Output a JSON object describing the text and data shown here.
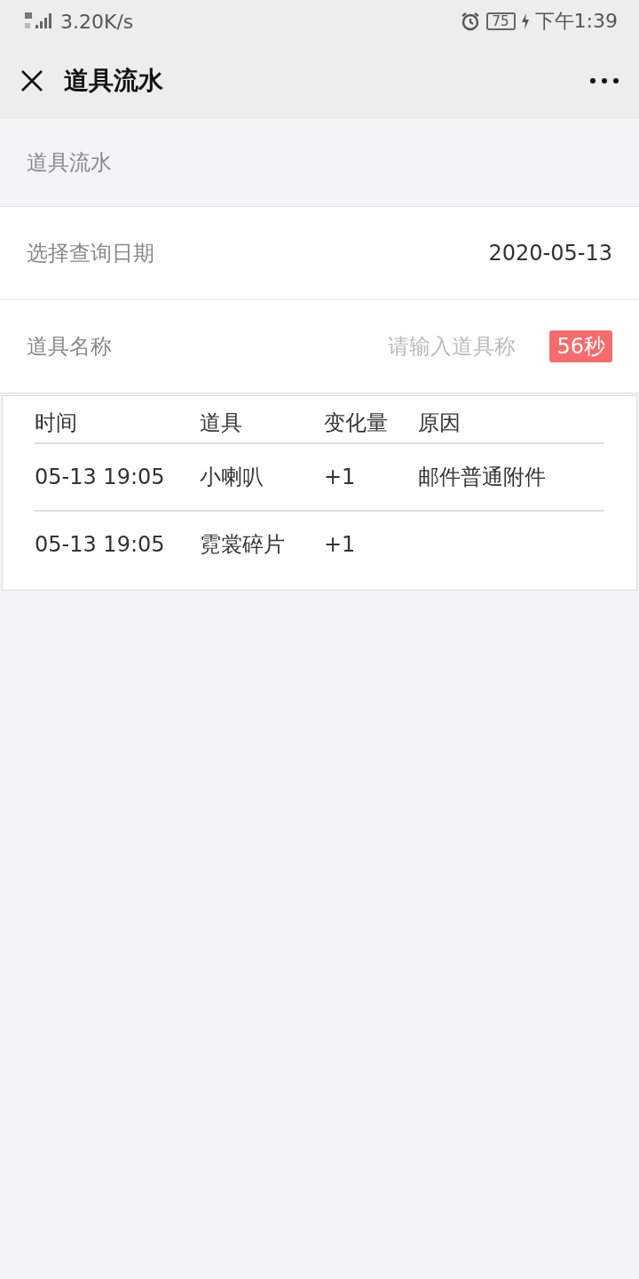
{
  "status_bar": {
    "network": "3.20K/s",
    "battery": "75",
    "time": "下午1:39"
  },
  "nav": {
    "title": "道具流水"
  },
  "section_title": "道具流水",
  "date_row": {
    "label": "选择查询日期",
    "value": "2020-05-13"
  },
  "name_row": {
    "label": "道具名称",
    "placeholder": "请输入道具称",
    "countdown": "56秒"
  },
  "table": {
    "columns": [
      "时间",
      "道具",
      "变化量",
      "原因"
    ],
    "rows": [
      [
        "05-13 19:05",
        "小喇叭",
        "+1",
        "邮件普通附件"
      ],
      [
        "05-13 19:05",
        "霓裳碎片",
        "+1"
      ]
    ]
  }
}
